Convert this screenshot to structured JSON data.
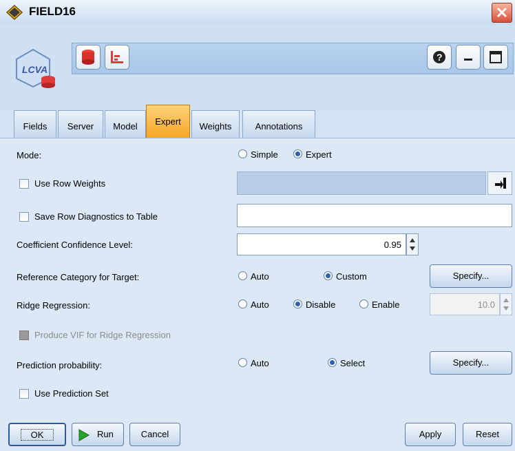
{
  "window": {
    "title": "FIELD16"
  },
  "tabs": [
    {
      "label": "Fields"
    },
    {
      "label": "Server"
    },
    {
      "label": "Model"
    },
    {
      "label": "Expert",
      "active": true
    },
    {
      "label": "Weights"
    },
    {
      "label": "Annotations"
    }
  ],
  "settings": {
    "mode_label": "Mode:",
    "mode_simple": "Simple",
    "mode_expert": "Expert",
    "use_row_weights": "Use Row Weights",
    "save_row_diag": "Save Row Diagnostics to Table",
    "coef_conf_label": "Coefficient Confidence Level:",
    "coef_conf_value": "0.95",
    "ref_cat_label": "Reference Category for Target:",
    "ref_auto": "Auto",
    "ref_custom": "Custom",
    "specify": "Specify...",
    "ridge_label": "Ridge Regression:",
    "ridge_auto": "Auto",
    "ridge_disable": "Disable",
    "ridge_enable": "Enable",
    "ridge_value": "10.0",
    "produce_vif": "Produce VIF for Ridge Regression",
    "pred_prob_label": "Prediction probability:",
    "pred_auto": "Auto",
    "pred_select": "Select",
    "use_pred_set": "Use Prediction Set"
  },
  "footer": {
    "ok": "OK",
    "run": "Run",
    "cancel": "Cancel",
    "apply": "Apply",
    "reset": "Reset"
  },
  "colors": {
    "active_tab": "#f5a523",
    "radio_selected": "#2f5fb3",
    "panel_background": "#dce8f5"
  }
}
